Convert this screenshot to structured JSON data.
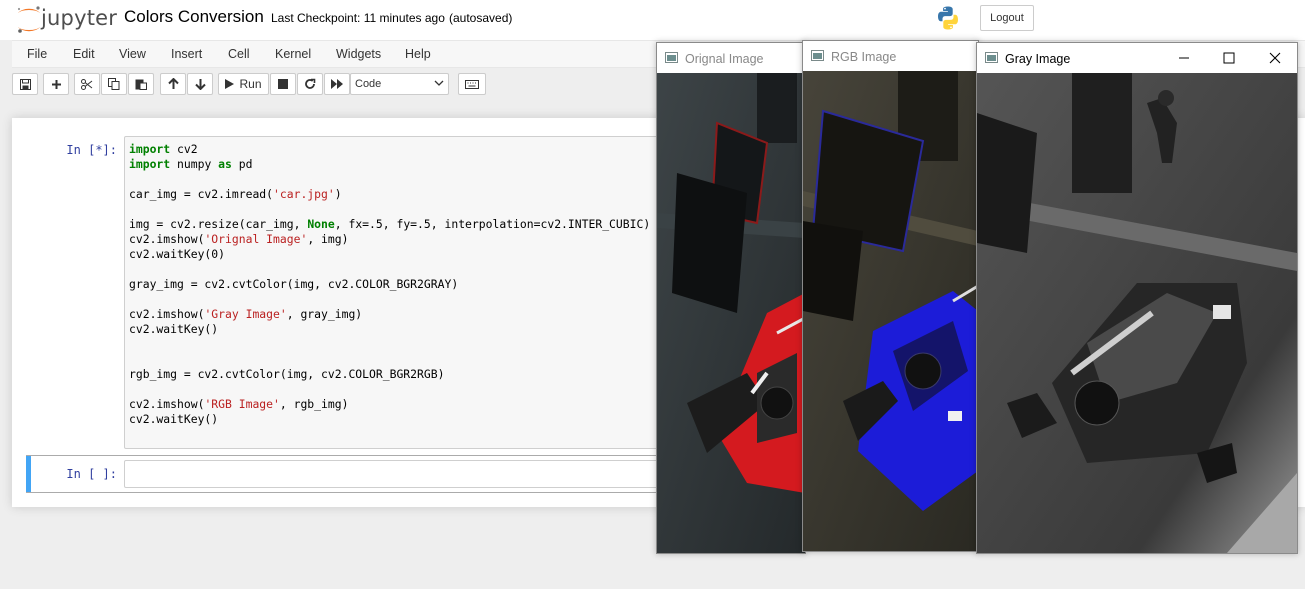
{
  "header": {
    "logo_text": "jupyter",
    "title": "Colors Conversion",
    "checkpoint": "Last Checkpoint: 11 minutes ago",
    "autosave": "(autosaved)",
    "logout_label": "Logout"
  },
  "menu": {
    "items": [
      "File",
      "Edit",
      "View",
      "Insert",
      "Cell",
      "Kernel",
      "Widgets",
      "Help"
    ]
  },
  "toolbar": {
    "run_label": "Run",
    "cell_type": "Code"
  },
  "cells": [
    {
      "prompt": "In [*]:",
      "code": [
        "import cv2",
        "import numpy as pd",
        "",
        "car_img = cv2.imread('car.jpg')",
        "",
        "img = cv2.resize(car_img, None, fx=.5, fy=.5, interpolation=cv2.INTER_CUBIC)",
        "cv2.imshow('Orignal Image', img)",
        "cv2.waitKey(0)",
        "",
        "gray_img = cv2.cvtColor(img, cv2.COLOR_BGR2GRAY)",
        "",
        "cv2.imshow('Gray Image', gray_img)",
        "cv2.waitKey()",
        "",
        "",
        "rgb_img = cv2.cvtColor(img, cv2.COLOR_BGR2RGB)",
        "",
        "cv2.imshow('RGB Image', rgb_img)",
        "cv2.waitKey()"
      ]
    },
    {
      "prompt": "In [ ]:",
      "code": []
    }
  ],
  "windows": {
    "original": {
      "title": "Orignal Image",
      "accent": "#e0141e"
    },
    "rgb": {
      "title": "RGB Image",
      "accent": "#1a1ae6"
    },
    "gray": {
      "title": "Gray Image",
      "accent": "#9a9a9a"
    }
  },
  "colors": {
    "prompt": "#303f9f",
    "keyword": "#008000",
    "string": "#ba2121",
    "selected_cell": "#42a5f5"
  }
}
